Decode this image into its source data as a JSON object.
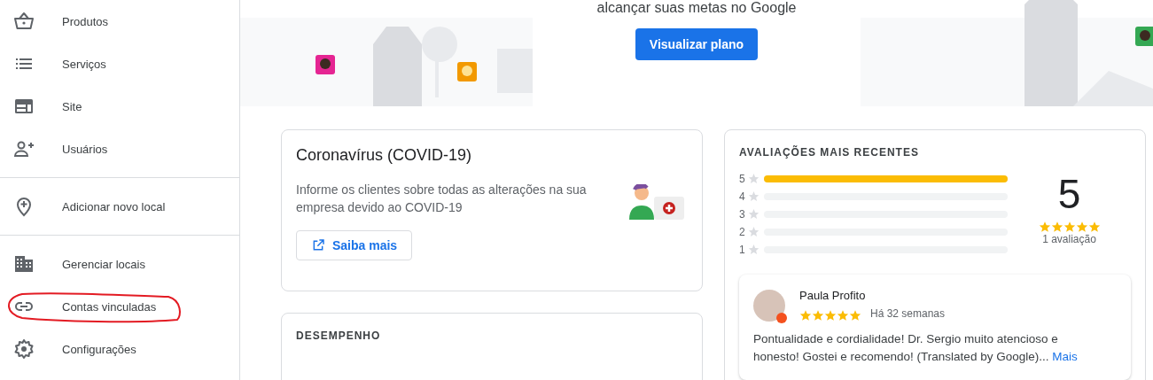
{
  "sidebar": {
    "groups": [
      {
        "items": [
          {
            "label": "Produtos"
          },
          {
            "label": "Serviços"
          },
          {
            "label": "Site"
          },
          {
            "label": "Usuários"
          }
        ]
      },
      {
        "items": [
          {
            "label": "Adicionar novo local"
          }
        ]
      },
      {
        "items": [
          {
            "label": "Gerenciar locais"
          },
          {
            "label": "Contas vinculadas"
          },
          {
            "label": "Configurações"
          }
        ]
      }
    ]
  },
  "banner": {
    "text": "alcançar suas metas no Google",
    "button": "Visualizar plano"
  },
  "covid_card": {
    "title": "Coronavírus (COVID-19)",
    "body": "Informe os clientes sobre todas as alterações na sua empresa devido ao COVID-19",
    "button": "Saiba mais"
  },
  "performance_card": {
    "title": "DESEMPENHO"
  },
  "reviews_card": {
    "title": "AVALIAÇÕES MAIS RECENTES",
    "distribution": [
      {
        "label": "5",
        "level": 1
      },
      {
        "label": "4",
        "level": 0
      },
      {
        "label": "3",
        "level": 0
      },
      {
        "label": "2",
        "level": 0
      },
      {
        "label": "1",
        "level": 0
      }
    ],
    "average": "5",
    "stars": 5,
    "count": "1 avaliação",
    "review": {
      "author": "Paula Profito",
      "stars": 5,
      "time": "Há 32 semanas",
      "text": "Pontualidade e cordialidade! Dr. Sergio muito atencioso e honesto! Gostei e recomendo! (Translated by Google)...",
      "more": "Mais"
    }
  }
}
